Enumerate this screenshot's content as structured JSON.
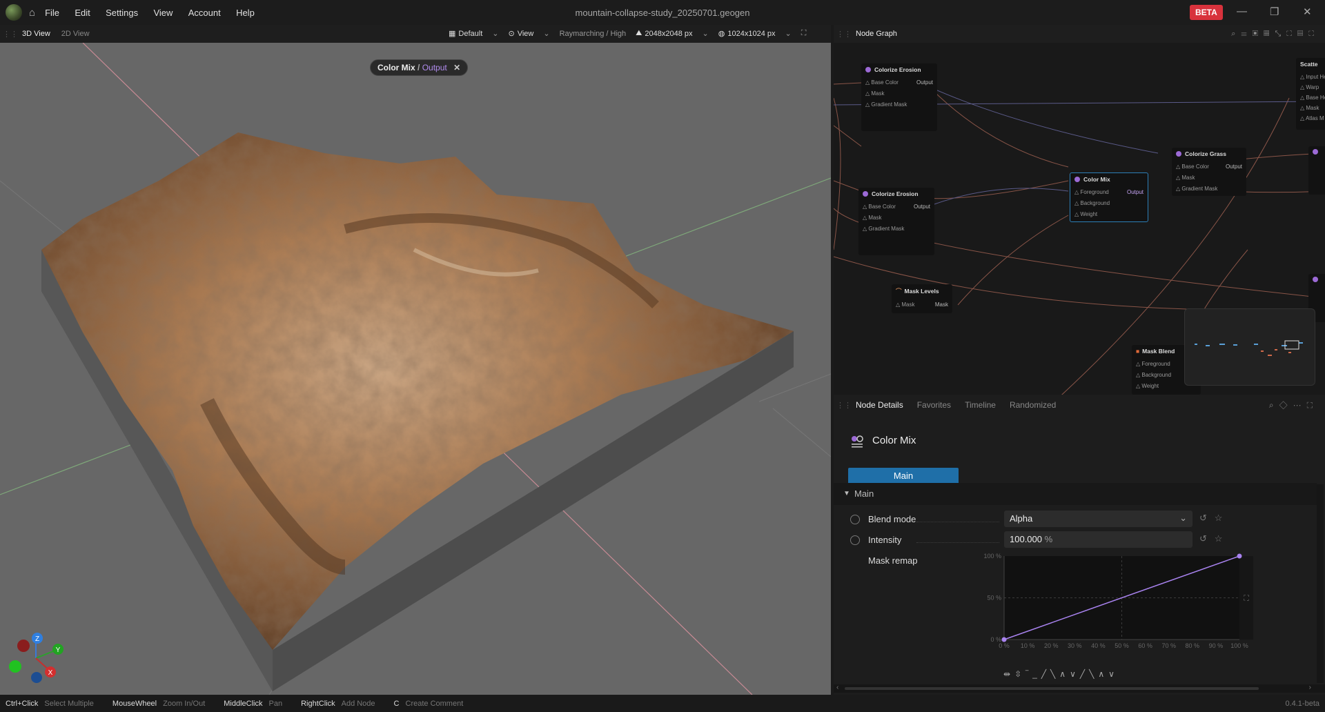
{
  "menu": [
    "File",
    "Edit",
    "Settings",
    "View",
    "Account",
    "Help"
  ],
  "document_title": "mountain-collapse-study_20250701.geogen",
  "beta_label": "BETA",
  "viewport": {
    "tabs": [
      "3D View",
      "2D View"
    ],
    "preset": "Default",
    "view_menu": "View",
    "render_mode": "Raymarching / High",
    "resolution": "2048x2048 px",
    "world_size": "1024x1024 px",
    "chip_node": "Color Mix",
    "chip_sep": "/",
    "chip_output": "Output",
    "axes": [
      "Z",
      "Y",
      "X"
    ]
  },
  "graph": {
    "title": "Node Graph",
    "nodes": [
      {
        "title": "Colorize Erosion",
        "ports": [
          "Base Color",
          "Mask",
          "Gradient Mask"
        ],
        "output": "Output"
      },
      {
        "title": "Colorize Erosion",
        "ports": [
          "Base Color",
          "Mask",
          "Gradient Mask"
        ],
        "output": "Output"
      },
      {
        "title": "Color Mix",
        "ports": [
          "Foreground",
          "Background",
          "Weight"
        ],
        "output": "Output"
      },
      {
        "title": "Colorize Grass",
        "ports": [
          "Base Color",
          "Mask",
          "Gradient Mask"
        ],
        "output": "Output"
      },
      {
        "title": "Mask Levels",
        "ports": [
          "Mask"
        ],
        "output": "Mask"
      },
      {
        "title": "Mask Blend",
        "ports": [
          "Foreground",
          "Background",
          "Weight"
        ],
        "output": ""
      },
      {
        "title": "Scatte",
        "ports": [
          "Input He",
          "Warp",
          "Base He",
          "Mask",
          "Atlas M"
        ],
        "output": ""
      }
    ]
  },
  "details": {
    "tabs": [
      "Node Details",
      "Favorites",
      "Timeline",
      "Randomized"
    ],
    "node_title": "Color Mix",
    "main_button": "Main",
    "section": "Main",
    "blend_mode_label": "Blend mode",
    "blend_mode_value": "Alpha",
    "intensity_label": "Intensity",
    "intensity_value": "100.000",
    "intensity_unit": "%",
    "mask_remap_label": "Mask remap",
    "y_ticks": [
      "100 %",
      "50 %",
      "0 %"
    ],
    "x_ticks": [
      "0 %",
      "10 %",
      "20 %",
      "30 %",
      "40 %",
      "50 %",
      "60 %",
      "70 %",
      "80 %",
      "90 %",
      "100 %"
    ]
  },
  "chart_data": {
    "type": "line",
    "title": "",
    "xlabel": "",
    "ylabel": "",
    "x": [
      0,
      100
    ],
    "y": [
      0,
      100
    ],
    "xlim": [
      0,
      100
    ],
    "ylim": [
      0,
      100
    ],
    "grid": true
  },
  "status": [
    {
      "key": "Ctrl+Click",
      "value": "Select Multiple"
    },
    {
      "key": "MouseWheel",
      "value": "Zoom In/Out"
    },
    {
      "key": "MiddleClick",
      "value": "Pan"
    },
    {
      "key": "RightClick",
      "value": "Add Node"
    },
    {
      "key": "C",
      "value": "Create Comment"
    }
  ],
  "version": "0.4.1-beta",
  "colors": {
    "accent": "#1f6fa8",
    "beta": "#d8323c",
    "curve": "#a983f0",
    "selection": "#2d7fb8"
  }
}
